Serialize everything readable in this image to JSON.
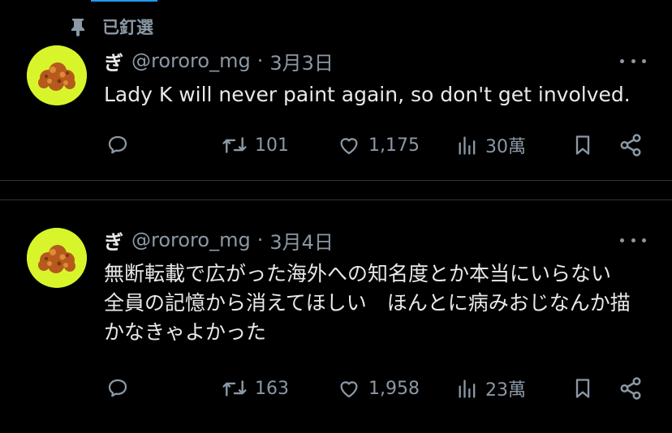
{
  "pinned_label": "已釘選",
  "tweets": [
    {
      "display_name": "ぎ",
      "handle": "@rororo_mg",
      "separator": "·",
      "date": "3月3日",
      "text": "Lady K will never paint again, so don't get involved.",
      "retweets": "101",
      "likes": "1,175",
      "views": "30萬"
    },
    {
      "display_name": "ぎ",
      "handle": "@rororo_mg",
      "separator": "·",
      "date": "3月4日",
      "text": "無断転載で広がった海外への知名度とか本当にいらない　全員の記憶から消えてほしい　ほんとに病みおじなんか描かなきゃよかった",
      "retweets": "163",
      "likes": "1,958",
      "views": "23萬"
    }
  ],
  "colors": {
    "background": "#000000",
    "text_primary": "#e7e9ea",
    "text_secondary": "#8b98a5",
    "divider": "#2f3336",
    "avatar_bg": "#d8f52b",
    "accent": "#1d9bf0"
  },
  "icons": {
    "pinned": "pin-icon",
    "reply": "reply-icon",
    "retweet": "retweet-icon",
    "like": "heart-icon",
    "views": "views-icon",
    "bookmark": "bookmark-icon",
    "share": "share-icon",
    "more": "more-icon"
  }
}
